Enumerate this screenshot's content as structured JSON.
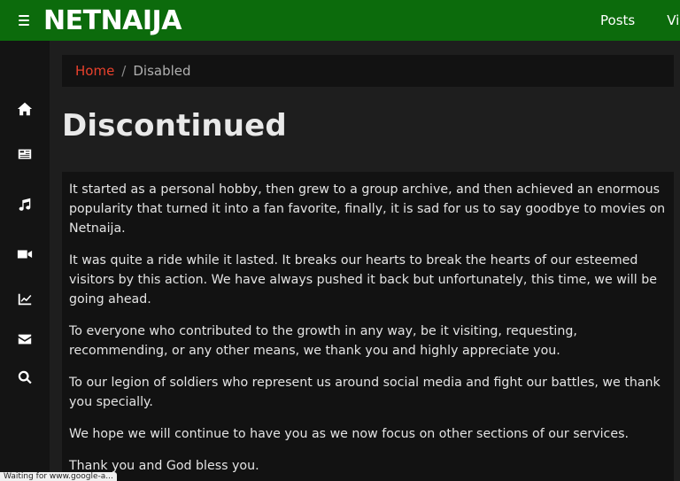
{
  "header": {
    "logo_text": "NETNAIJA",
    "nav": [
      "Posts",
      "Vid"
    ]
  },
  "sidebar": {
    "icons": [
      "home-icon",
      "news-icon",
      "music-icon",
      "video-icon",
      "chart-icon",
      "mail-icon",
      "search-icon"
    ]
  },
  "breadcrumb": {
    "home": "Home",
    "separator": "/",
    "current": "Disabled"
  },
  "page": {
    "title": "Discontinued",
    "paragraphs": [
      "It started as a personal hobby, then grew to a group archive, and then achieved an enormous popularity that turned it into a fan favorite, finally, it is sad for us to say goodbye to movies on Netnaija.",
      "It was quite a ride while it lasted. It breaks our hearts to break the hearts of our esteemed visitors by this action. We have always pushed it back but unfortunately, this time, we will be going ahead.",
      "To everyone who contributed to the growth in any way, be it visiting, requesting, recommending, or any other means, we thank you and highly appreciate you.",
      "To our legion of soldiers who represent us around social media and fight our battles, we thank you specially.",
      "We hope we will continue to have you as we now focus on other sections of our services.",
      "Thank you and God bless you."
    ]
  },
  "status": {
    "text": "Waiting for www.google-a..."
  },
  "colors": {
    "header_bg": "#0c6b0c",
    "link_accent": "#e8412c",
    "content_bg": "#121212",
    "page_bg": "#1e1e1e"
  }
}
